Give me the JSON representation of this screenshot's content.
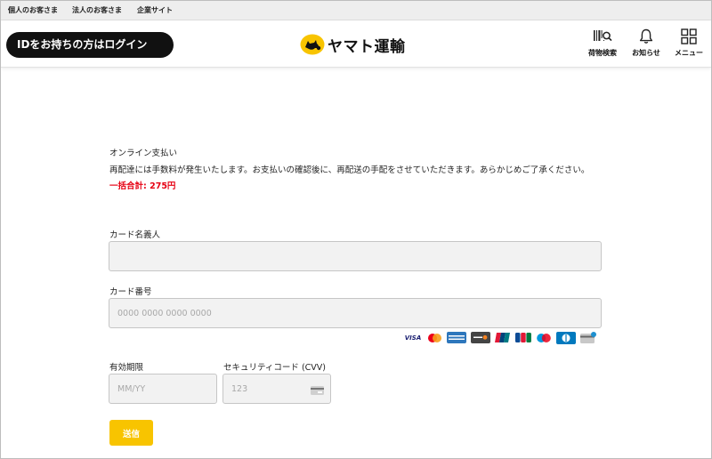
{
  "topbar": {
    "links": [
      "個人のお客さま",
      "法人のお客さま",
      "企業サイト"
    ]
  },
  "header": {
    "login_label": "IDをお持ちの方はログイン",
    "logo_text": "ヤマト運輸",
    "nav": [
      {
        "label": "荷物検索",
        "icon": "barcode-search-icon"
      },
      {
        "label": "お知らせ",
        "icon": "bell-icon"
      },
      {
        "label": "メニュー",
        "icon": "grid-menu-icon"
      }
    ]
  },
  "payment": {
    "section_title": "オンライン支払い",
    "description": "再配達には手数料が発生いたします。お支払いの確認後に、再配送の手配をさせていただきます。あらかじめご了承ください。",
    "total": "一括合計: 275円"
  },
  "form": {
    "card_name": {
      "label": "カード名義人",
      "value": "",
      "placeholder": ""
    },
    "card_number": {
      "label": "カード番号",
      "value": "",
      "placeholder": "0000 0000 0000 0000"
    },
    "expiry": {
      "label": "有効期限",
      "value": "",
      "placeholder": "MM/YY"
    },
    "cvv": {
      "label": "セキュリティコード (CVV)",
      "value": "",
      "placeholder": "123"
    },
    "submit_label": "送信"
  },
  "brands": [
    "VISA",
    "Mastercard",
    "American Express",
    "DISCOVER",
    "UnionPay",
    "JCB",
    "Maestro",
    "Diners Club",
    "generic-card"
  ],
  "colors": {
    "accent": "#f8c400",
    "total_red": "#e60012",
    "login_bg": "#111111"
  }
}
